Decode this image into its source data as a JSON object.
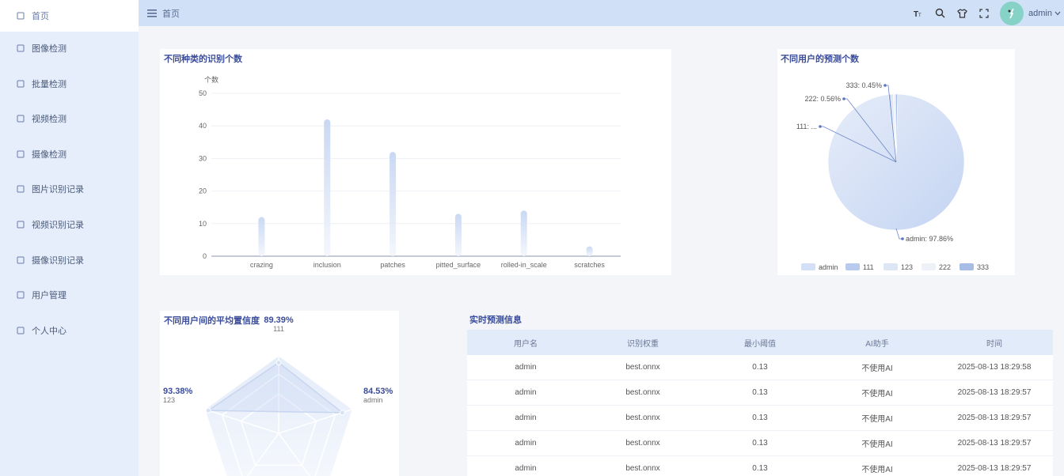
{
  "sidebar": {
    "items": [
      {
        "label": "首页",
        "icon": "home-icon",
        "active": true
      },
      {
        "label": "图像检测",
        "icon": "image-icon"
      },
      {
        "label": "批量检测",
        "icon": "batch-icon"
      },
      {
        "label": "视频检测",
        "icon": "video-icon"
      },
      {
        "label": "摄像检测",
        "icon": "camera-icon"
      },
      {
        "label": "图片识别记录",
        "icon": "record-icon"
      },
      {
        "label": "视频识别记录",
        "icon": "video-record-icon"
      },
      {
        "label": "摄像识别记录",
        "icon": "camera-record-icon"
      },
      {
        "label": "用户管理",
        "icon": "user-icon"
      },
      {
        "label": "个人中心",
        "icon": "profile-icon"
      }
    ]
  },
  "header": {
    "breadcrumb": "首页",
    "username": "admin"
  },
  "bar_card": {
    "title": "不同种类的识别个数"
  },
  "pie_card": {
    "title": "不同用户的预测个数"
  },
  "radar_card": {
    "title": "不同用户间的平均置信度",
    "labels": [
      {
        "value": "89.39%",
        "name": "111"
      },
      {
        "value": "93.38%",
        "name": "123"
      },
      {
        "value": "84.53%",
        "name": "admin"
      }
    ]
  },
  "table": {
    "title": "实时预测信息",
    "headers": [
      "用户名",
      "识别权重",
      "最小阈值",
      "AI助手",
      "时间"
    ],
    "rows": [
      [
        "admin",
        "best.onnx",
        "0.13",
        "不使用AI",
        "2025-08-13 18:29:58"
      ],
      [
        "admin",
        "best.onnx",
        "0.13",
        "不使用AI",
        "2025-08-13 18:29:57"
      ],
      [
        "admin",
        "best.onnx",
        "0.13",
        "不使用AI",
        "2025-08-13 18:29:57"
      ],
      [
        "admin",
        "best.onnx",
        "0.13",
        "不使用AI",
        "2025-08-13 18:29:57"
      ],
      [
        "admin",
        "best.onnx",
        "0.13",
        "不使用AI",
        "2025-08-13 18:29:57"
      ]
    ]
  },
  "chart_data": [
    {
      "type": "bar",
      "title": "不同种类的识别个数",
      "ylabel": "个数",
      "xlabel": "",
      "categories": [
        "crazing",
        "inclusion",
        "patches",
        "pitted_surface",
        "rolled-in_scale",
        "scratches"
      ],
      "values": [
        12,
        42,
        32,
        13,
        14,
        3
      ],
      "ylim": [
        0,
        50
      ],
      "yticks": [
        0,
        10,
        20,
        30,
        40,
        50
      ],
      "grid": true,
      "colors": {
        "bar": "#c9d8f3"
      }
    },
    {
      "type": "pie",
      "title": "不同用户的预测个数",
      "slices": [
        {
          "name": "admin",
          "value": 97.86,
          "label": "admin: 97.86%",
          "color": "#d3e0f6"
        },
        {
          "name": "111",
          "value": 0.6,
          "label": "111: ...",
          "color": "#b8cbee"
        },
        {
          "name": "123",
          "value": 0.5,
          "label": "",
          "color": "#dde6f5"
        },
        {
          "name": "222",
          "value": 0.56,
          "label": "222: 0.56%",
          "color": "#eef2f8"
        },
        {
          "name": "333",
          "value": 0.45,
          "label": "333: 0.45%",
          "color": "#a8bde6"
        }
      ],
      "legend": [
        "admin",
        "111",
        "123",
        "222",
        "333"
      ],
      "legend_position": "bottom"
    },
    {
      "type": "radar",
      "title": "不同用户间的平均置信度",
      "axes": [
        "111",
        "admin",
        "123"
      ],
      "values": [
        89.39,
        84.53,
        93.38
      ]
    }
  ]
}
